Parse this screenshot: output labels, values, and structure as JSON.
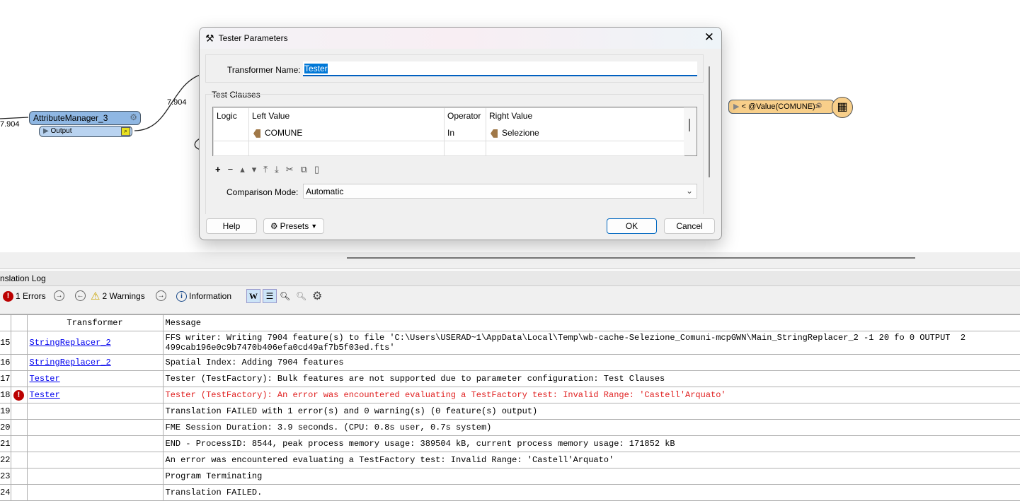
{
  "canvas": {
    "left_count": "7.904",
    "link_count": "7.904",
    "attribute_manager": {
      "name": "AttributeManager_3",
      "port": "Output"
    },
    "right_node": {
      "name": "< @Value(COMUNE)>"
    }
  },
  "dialog": {
    "title": "Tester Parameters",
    "transformer_name_label": "Transformer Name:",
    "transformer_name_value": "Tester",
    "test_clauses_label": "Test Clauses",
    "columns": [
      "Logic",
      "Left Value",
      "Operator",
      "Right Value"
    ],
    "clauses": [
      {
        "logic": "",
        "left": "COMUNE",
        "operator": "In",
        "right": "Selezione"
      }
    ],
    "comparison_mode_label": "Comparison Mode:",
    "comparison_mode_value": "Automatic",
    "help": "Help",
    "presets": "Presets",
    "ok": "OK",
    "cancel": "Cancel"
  },
  "log": {
    "title": "nslation Log",
    "errors": "1 Errors",
    "warnings": "2 Warnings",
    "information": "Information",
    "columns": {
      "transformer": "Transformer",
      "message": "Message"
    },
    "rows": [
      {
        "num": "15",
        "transformer": "StringReplacer_2",
        "message": "FFS writer: Writing 7904 feature(s) to file 'C:\\Users\\USERAD~1\\AppData\\Local\\Temp\\wb-cache-Selezione_Comuni-mcpGWN\\Main_StringReplacer_2 -1 20 fo 0 OUTPUT  2\n499cab196e0c9b7470b406efa0cd49af7b5f03ed.fts'"
      },
      {
        "num": "16",
        "transformer": "StringReplacer_2",
        "message": "Spatial Index: Adding 7904 features"
      },
      {
        "num": "17",
        "transformer": "Tester",
        "message": "Tester (TestFactory): Bulk features are not supported due to parameter configuration: Test Clauses"
      },
      {
        "num": "18",
        "transformer": "Tester",
        "message": "Tester (TestFactory): An error was encountered evaluating a TestFactory test: Invalid Range: 'Castell'Arquato'",
        "error": true
      },
      {
        "num": "19",
        "transformer": "",
        "message": "Translation FAILED with 1 error(s) and 0 warning(s) (0 feature(s) output)"
      },
      {
        "num": "20",
        "transformer": "",
        "message": "FME Session Duration: 3.9 seconds. (CPU: 0.8s user, 0.7s system)"
      },
      {
        "num": "21",
        "transformer": "",
        "message": "END - ProcessID: 8544, peak process memory usage: 389504 kB, current process memory usage: 171852 kB"
      },
      {
        "num": "22",
        "transformer": "",
        "message": "An error was encountered evaluating a TestFactory test: Invalid Range: 'Castell'Arquato'"
      },
      {
        "num": "23",
        "transformer": "",
        "message": "Program Terminating"
      },
      {
        "num": "24",
        "transformer": "",
        "message": "Translation FAILED."
      }
    ]
  }
}
